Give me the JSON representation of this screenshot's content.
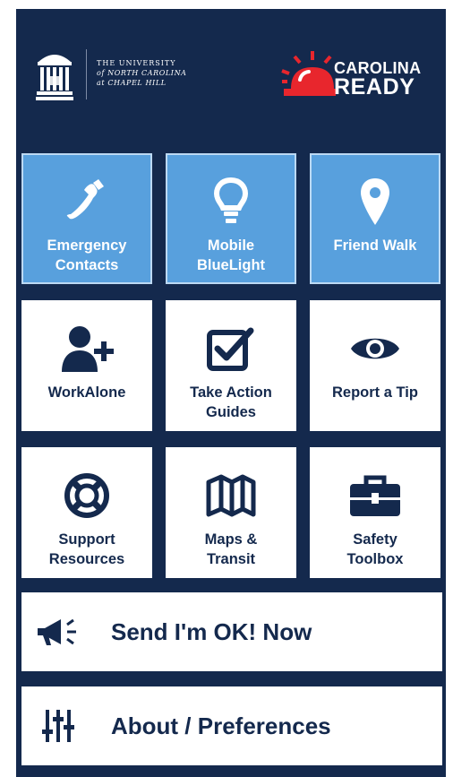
{
  "header": {
    "unc_lines": [
      "THE UNIVERSITY",
      "of NORTH CAROLINA",
      "at CHAPEL HILL"
    ],
    "brand_line1": "CAROLINA",
    "brand_line2": "READY"
  },
  "tiles": [
    {
      "label": "Emergency\nContacts",
      "icon": "phone-icon",
      "style": "blue"
    },
    {
      "label": "Mobile\nBlueLight",
      "icon": "lightbulb-icon",
      "style": "blue"
    },
    {
      "label": "Friend Walk",
      "icon": "map-pin-icon",
      "style": "blue"
    },
    {
      "label": "WorkAlone",
      "icon": "add-person-icon",
      "style": "white"
    },
    {
      "label": "Take Action\nGuides",
      "icon": "checkbox-icon",
      "style": "white"
    },
    {
      "label": "Report a Tip",
      "icon": "eye-icon",
      "style": "white"
    },
    {
      "label": "Support\nResources",
      "icon": "life-ring-icon",
      "style": "white"
    },
    {
      "label": "Maps &\nTransit",
      "icon": "map-icon",
      "style": "white"
    },
    {
      "label": "Safety\nToolbox",
      "icon": "toolbox-icon",
      "style": "white"
    }
  ],
  "actions": {
    "send_ok": {
      "label": "Send I'm OK! Now",
      "icon": "megaphone-icon"
    },
    "about": {
      "label": "About / Preferences",
      "icon": "sliders-icon"
    }
  },
  "colors": {
    "background": "#14294d",
    "tile_blue": "#58a0dd",
    "tile_white": "#ffffff",
    "siren_red": "#e8262d"
  }
}
